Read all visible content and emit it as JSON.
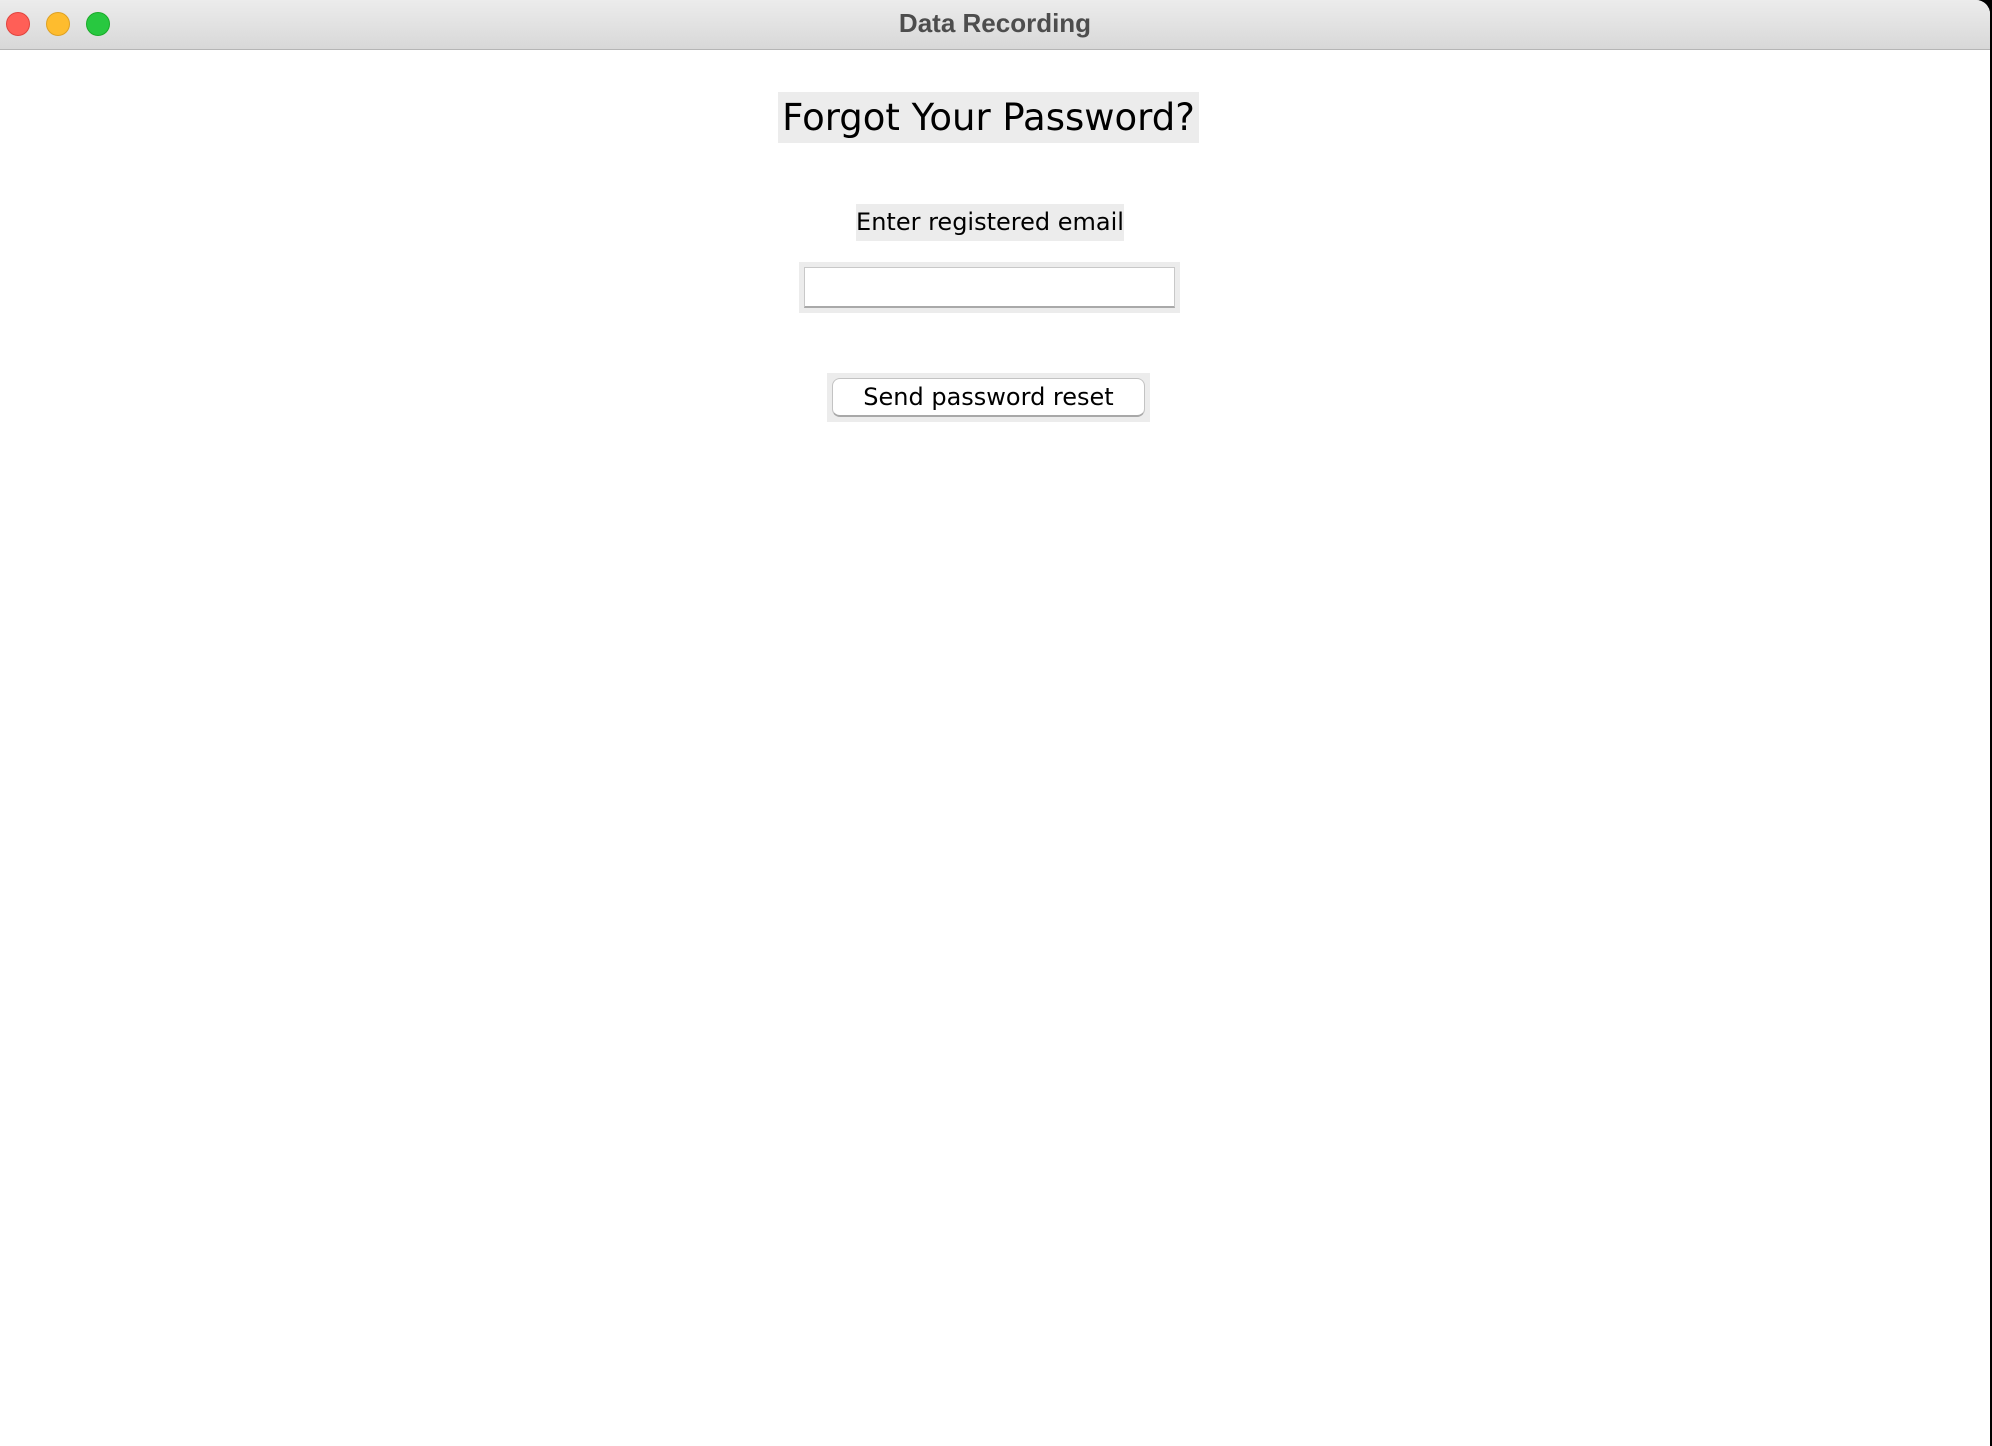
{
  "window": {
    "title": "Data Recording",
    "controls": {
      "close_color": "#ff5f57",
      "minimize_color": "#febc2e",
      "zoom_color": "#28c840"
    }
  },
  "form": {
    "heading": "Forgot Your Password?",
    "email_label": "Enter registered email",
    "email_value": "",
    "email_placeholder": "",
    "submit_label": "Send password reset"
  }
}
